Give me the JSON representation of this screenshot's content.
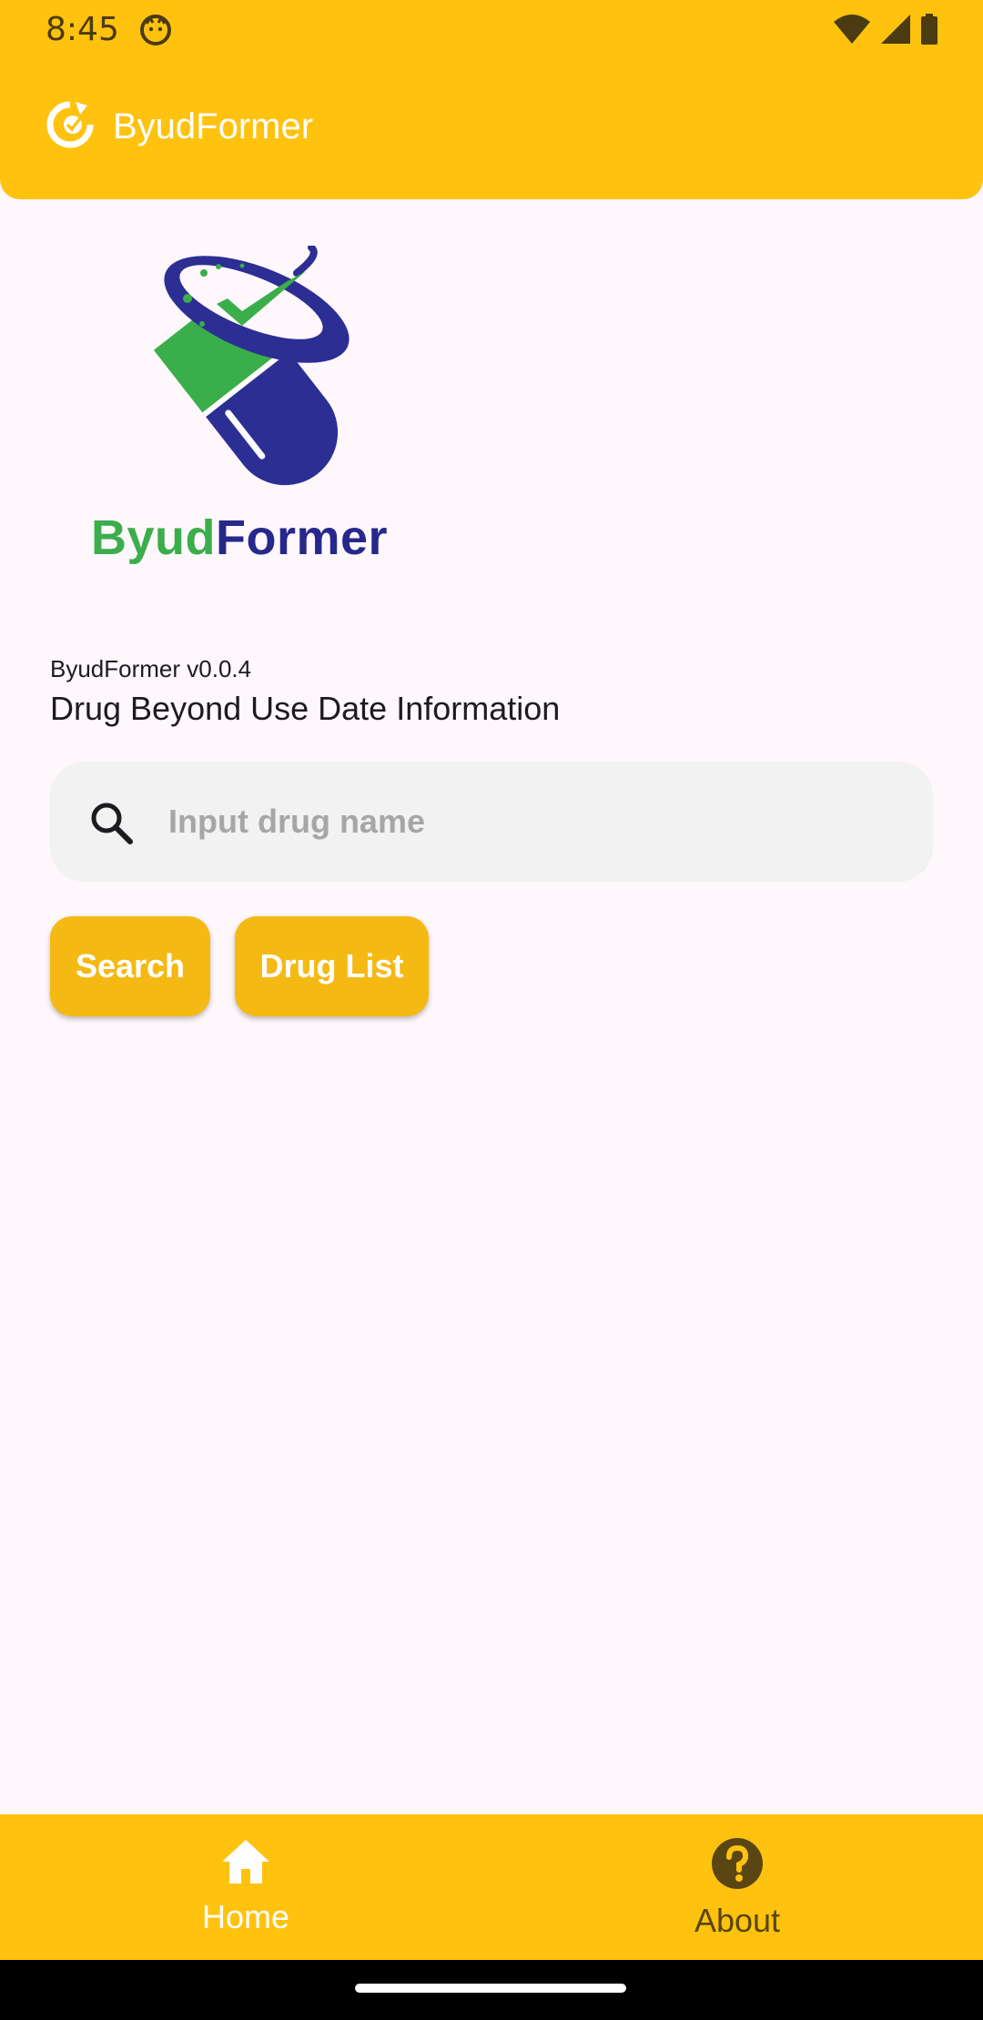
{
  "status_bar": {
    "time": "8:45"
  },
  "app_bar": {
    "title": "ByudFormer"
  },
  "logo": {
    "text_green": "Byud",
    "text_blue": "Former"
  },
  "info": {
    "version": "ByudFormer v0.0.4",
    "subtitle": "Drug Beyond Use Date Information"
  },
  "search": {
    "placeholder": "Input drug name",
    "value": ""
  },
  "buttons": {
    "search_label": "Search",
    "drug_list_label": "Drug List"
  },
  "bottom_nav": {
    "items": [
      {
        "label": "Home",
        "icon": "home-icon",
        "selected": true
      },
      {
        "label": "About",
        "icon": "help-icon",
        "selected": false
      }
    ]
  },
  "colors": {
    "accent": "#FFC20E",
    "button": "#F5B914",
    "logo_green": "#3AAE4A",
    "logo_blue": "#26288C",
    "background": "#FEF7FB"
  }
}
